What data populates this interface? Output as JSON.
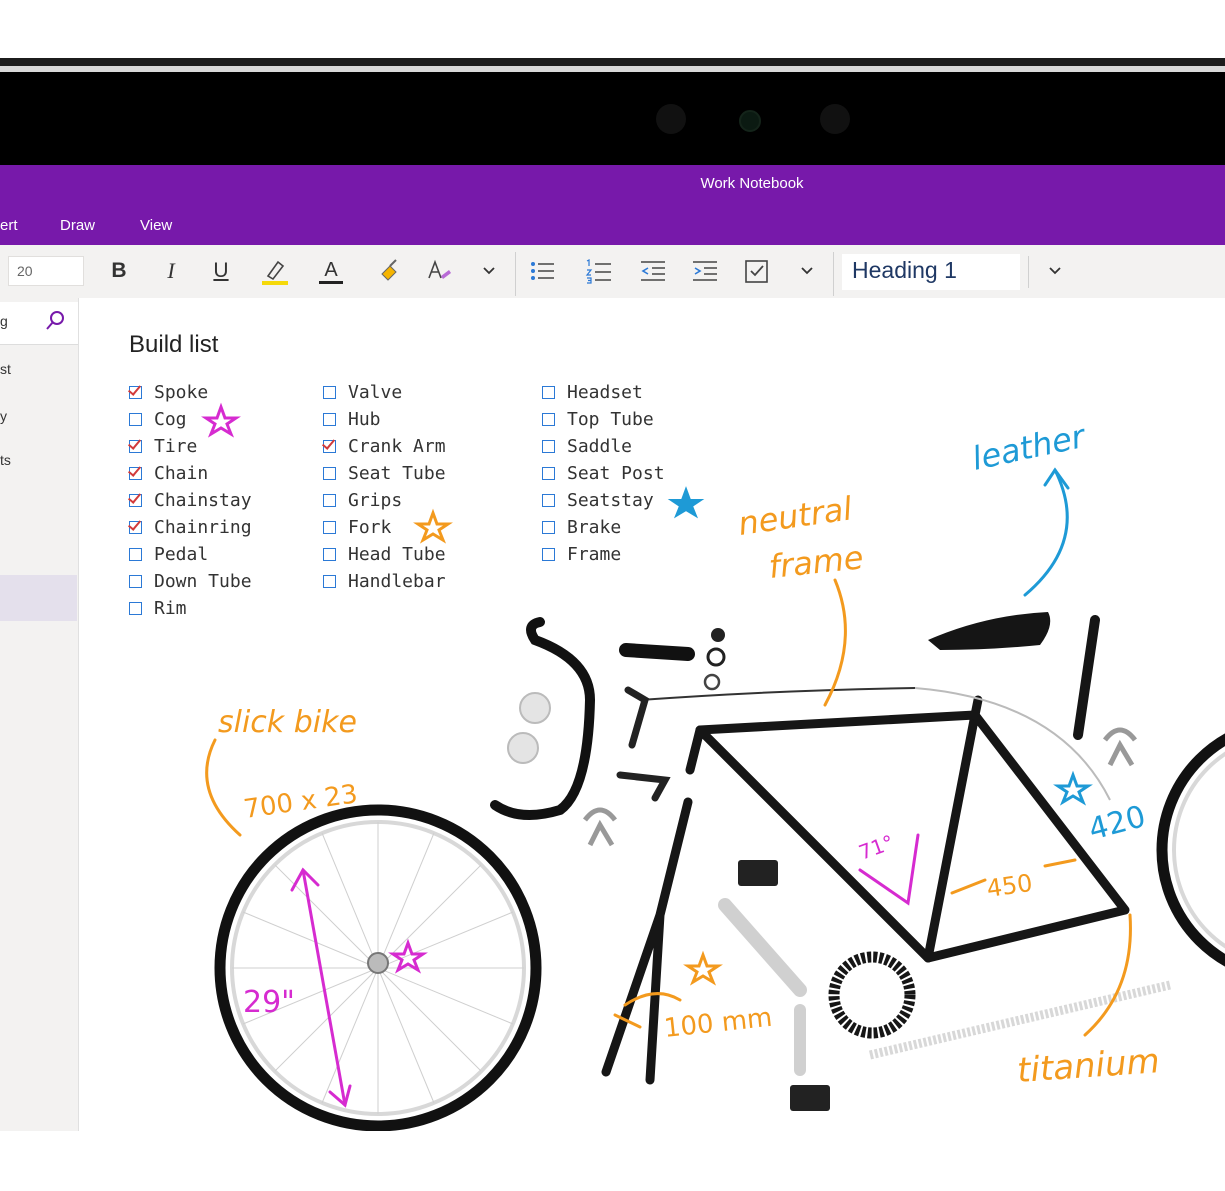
{
  "window": {
    "title": "Work Notebook"
  },
  "menu": {
    "items": [
      "ert",
      "Draw",
      "View"
    ]
  },
  "toolbar": {
    "font_size": "20",
    "bold_label": "B",
    "italic_label": "I",
    "underline_label": "U",
    "font_color_label": "A",
    "style": "Heading 1",
    "icons": [
      "bold-icon",
      "italic-icon",
      "underline-icon",
      "highlight-icon",
      "font-color-icon",
      "format-painter-icon",
      "text-effects-icon",
      "chevron-down-icon",
      "bullet-list-icon",
      "numbered-list-icon",
      "outdent-icon",
      "indent-icon",
      "todo-tag-icon",
      "chevron-down-icon"
    ],
    "colors": {
      "highlight": "#f5d90a",
      "font_color": "#222222"
    }
  },
  "sidebar": {
    "search_text": "g",
    "items": [
      "st",
      "y",
      "ts"
    ]
  },
  "page": {
    "title": "Build list",
    "columns": [
      [
        {
          "text": "Spoke",
          "checked": true
        },
        {
          "text": "Cog",
          "checked": false
        },
        {
          "text": "Tire",
          "checked": true
        },
        {
          "text": "Chain",
          "checked": true
        },
        {
          "text": "Chainstay",
          "checked": true
        },
        {
          "text": "Chainring",
          "checked": true
        },
        {
          "text": "Pedal",
          "checked": false
        },
        {
          "text": "Down Tube",
          "checked": false
        },
        {
          "text": "Rim",
          "checked": false
        }
      ],
      [
        {
          "text": "Valve",
          "checked": false
        },
        {
          "text": "Hub",
          "checked": false
        },
        {
          "text": "Crank Arm",
          "checked": true
        },
        {
          "text": "Seat Tube",
          "checked": false
        },
        {
          "text": "Grips",
          "checked": false
        },
        {
          "text": "Fork",
          "checked": false
        },
        {
          "text": "Head Tube",
          "checked": false
        },
        {
          "text": "Handlebar",
          "checked": false
        }
      ],
      [
        {
          "text": "Headset",
          "checked": false
        },
        {
          "text": "Top Tube",
          "checked": false
        },
        {
          "text": "Saddle",
          "checked": false
        },
        {
          "text": "Seat Post",
          "checked": false
        },
        {
          "text": "Seatstay",
          "checked": false
        },
        {
          "text": "Brake",
          "checked": false
        },
        {
          "text": "Frame",
          "checked": false
        }
      ]
    ],
    "annotations": {
      "slick_bike": "slick bike",
      "tire_size": "700 x 23",
      "wheel_size": "29\"",
      "neutral_frame_1": "neutral",
      "neutral_frame_2": "frame",
      "leather": "leather",
      "angle": "71°",
      "tube_450": "450",
      "tube_420": "420",
      "fork_100mm": "100 mm",
      "titanium": "titanium"
    },
    "colors": {
      "orange_ink": "#f39a1e",
      "magenta_ink": "#d62bd0",
      "blue_ink": "#1e9ad6",
      "checkbox": "#2b79d6",
      "check": "#d23b3b"
    }
  }
}
